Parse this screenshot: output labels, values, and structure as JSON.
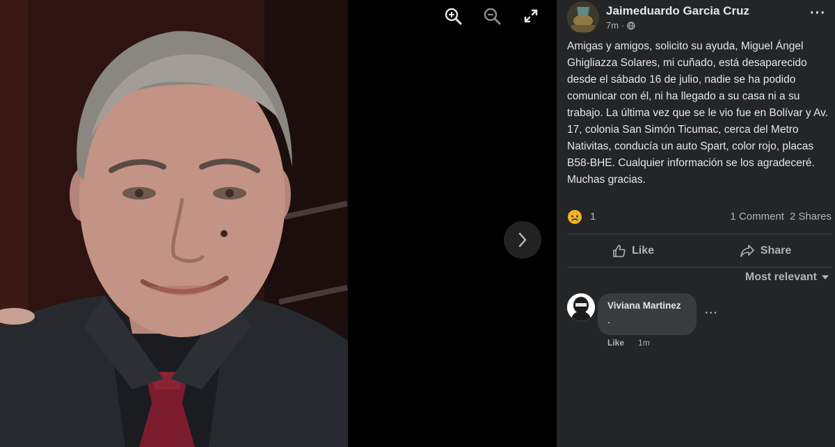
{
  "viewer": {
    "tools": [
      {
        "name": "zoom-in-icon"
      },
      {
        "name": "zoom-out-icon"
      },
      {
        "name": "fullscreen-icon"
      }
    ],
    "next_icon": "chevron-right-icon"
  },
  "post": {
    "author": "Jaimeduardo Garcia Cruz",
    "time": "7m",
    "separator": "·",
    "privacy_icon": "globe-icon",
    "more_label": "···",
    "text": "Amigas y amigos, solicito su ayuda, Miguel Ángel Ghigliazza Solares, mi cuñado, está desaparecido desde el sábado 16 de julio, nadie se ha podido comunicar con él, ni ha llegado a su casa ni a su trabajo. La última vez que se le vio fue en Bolívar y Av. 17, colonia San Simón Ticumac, cerca del Metro Nativitas, conducía un auto Spart, color rojo, placas B58-BHE. Cualquier información se los agradeceré. Muchas gracias.",
    "reaction_icon": "sad-reaction-icon",
    "reaction_count": "1",
    "comments_count": "1 Comment",
    "shares_count": "2 Shares",
    "actions": {
      "like": "Like",
      "share": "Share"
    },
    "sort_label": "Most relevant"
  },
  "comment": {
    "author": "Viviana Martinez",
    "text": ".",
    "like_label": "Like",
    "time": "1m",
    "more_label": "···"
  },
  "colors": {
    "panel_bg": "#242526",
    "bubble_bg": "#3a3b3c",
    "text_primary": "#e4e6eb",
    "text_secondary": "#b0b3b8",
    "divider": "#3e4042"
  }
}
